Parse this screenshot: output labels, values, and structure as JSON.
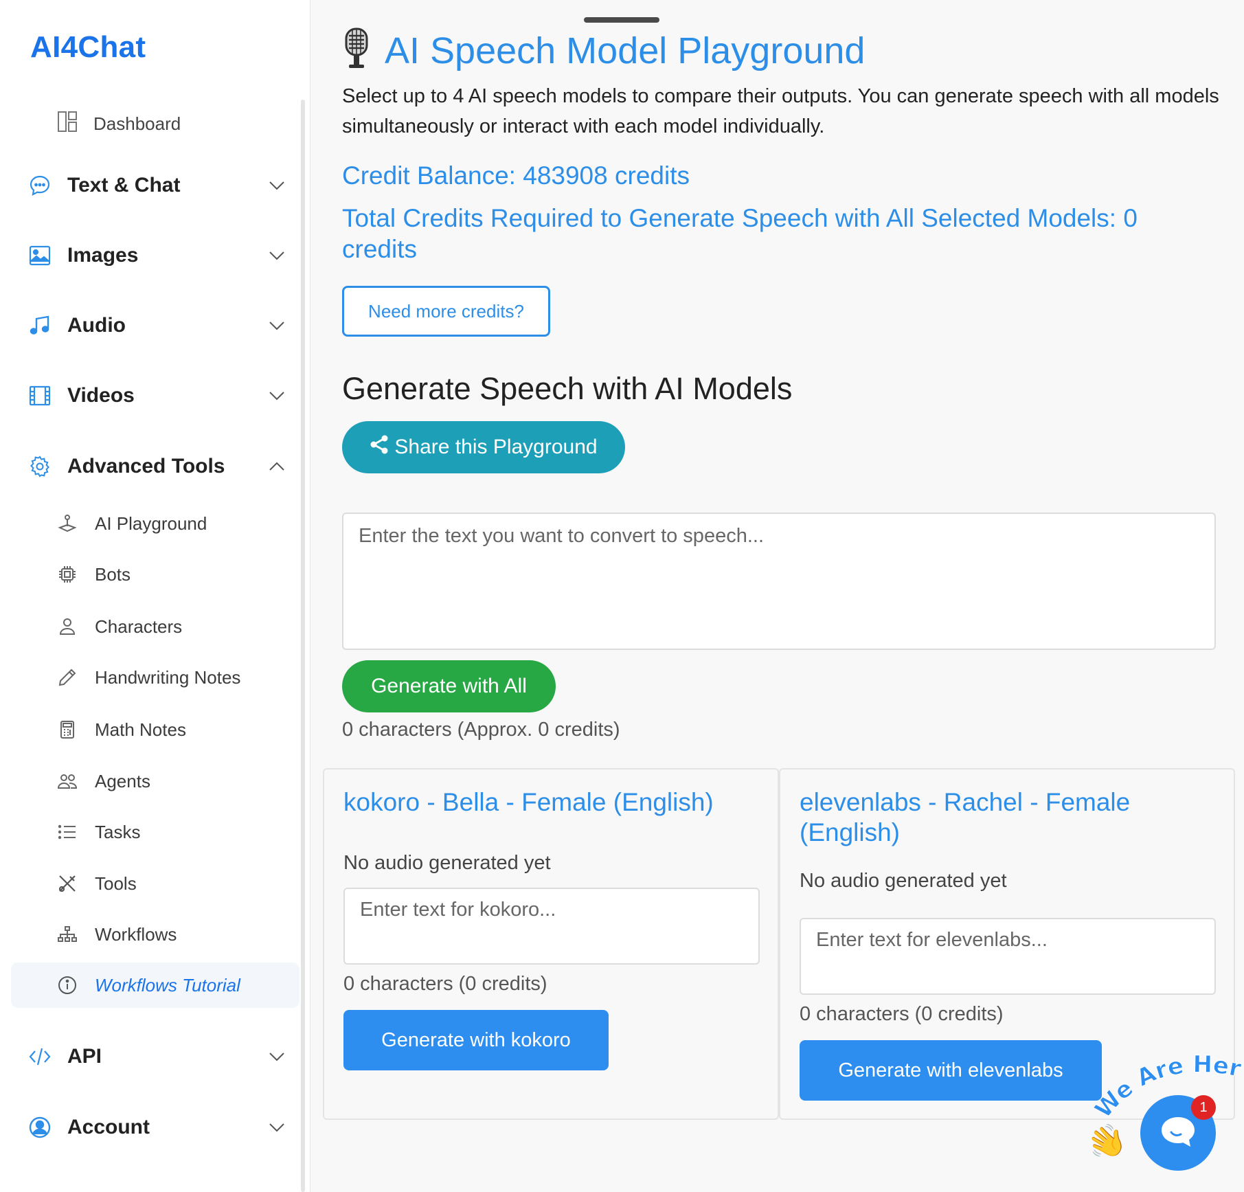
{
  "sidebar": {
    "brand": "AI4Chat",
    "dashboard": "Dashboard",
    "sections": {
      "text_chat": "Text & Chat",
      "images": "Images",
      "audio": "Audio",
      "videos": "Videos",
      "advanced_tools": "Advanced Tools",
      "api": "API",
      "account": "Account"
    },
    "advanced_items": {
      "ai_playground": "AI Playground",
      "bots": "Bots",
      "characters": "Characters",
      "handwriting_notes": "Handwriting Notes",
      "math_notes": "Math Notes",
      "agents": "Agents",
      "tasks": "Tasks",
      "tools": "Tools",
      "workflows": "Workflows",
      "workflows_tutorial": "Workflows Tutorial"
    }
  },
  "main": {
    "title": "AI Speech Model Playground",
    "intro": "Select up to 4 AI speech models to compare their outputs. You can generate speech with all models simultaneously or interact with each model individually.",
    "credit_balance": "Credit Balance: 483908 credits",
    "credits_required": "Total Credits Required to Generate Speech with All Selected Models: 0 credits",
    "need_credits_label": "Need more credits?",
    "generate_heading": "Generate Speech with AI Models",
    "share_label": "Share this Playground",
    "text_placeholder": "Enter the text you want to convert to speech...",
    "generate_all_label": "Generate with All",
    "char_count": "0 characters (Approx. 0 credits)",
    "models": [
      {
        "title": "kokoro - Bella - Female (English)",
        "status": "No audio generated yet",
        "placeholder": "Enter text for kokoro...",
        "count": "0 characters (0 credits)",
        "button": "Generate with kokoro"
      },
      {
        "title": "elevenlabs - Rachel - Female (English)",
        "status": "No audio generated yet",
        "placeholder": "Enter text for elevenlabs...",
        "count": "0 characters (0 credits)",
        "button": "Generate with elevenlabs"
      }
    ]
  },
  "chat_widget": {
    "badge": "1",
    "caption": "We Are Here!"
  },
  "colors": {
    "accent": "#2d8ee8",
    "brand": "#1a73e8",
    "share": "#1e9fb8",
    "success": "#28a745",
    "primary_button": "#2d8ef0"
  },
  "icons": {
    "title": "microphone-icon",
    "dashboard": "dashboard-grid-icon",
    "text_chat": "chat-bubble-icon",
    "images": "image-icon",
    "audio": "music-note-icon",
    "videos": "film-icon",
    "advanced_tools": "gear-icon",
    "api": "code-icon",
    "account": "user-circle-icon"
  }
}
